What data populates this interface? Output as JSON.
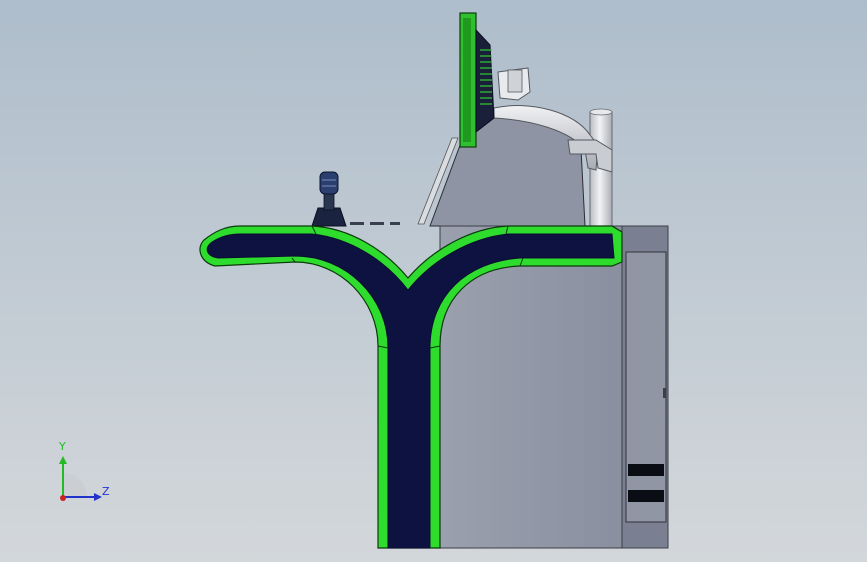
{
  "triad": {
    "y_label": "Y",
    "z_label": "Z",
    "y_color": "#22bb22",
    "z_color": "#2233cc",
    "x_color": "#cc2222"
  },
  "colors": {
    "background_top": "#aebdcb",
    "background_bottom": "#d3d7da",
    "console_outline": "#22dd22",
    "console_fill": "#0d1240",
    "cabinet_body": "#8f96a5",
    "cabinet_dark": "#6f7585",
    "monitor_green": "#33cc33",
    "metal_light": "#dfe2e6"
  },
  "components": [
    "joystick",
    "monitor",
    "monitor-arm",
    "support-pole",
    "console-desk",
    "console-pedestal",
    "cabinet",
    "side-door",
    "vent-slots"
  ]
}
